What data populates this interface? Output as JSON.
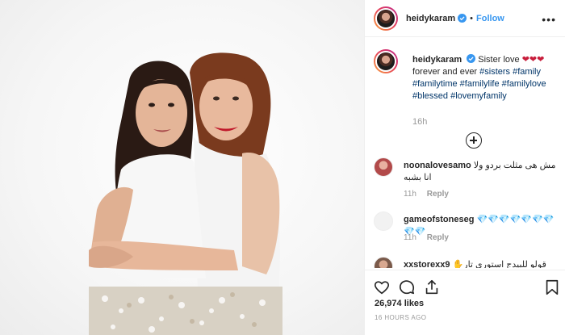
{
  "post": {
    "username": "heidykaram",
    "follow_label": "Follow",
    "more_label": "•••",
    "caption_prefix": "Sister love ",
    "caption_hearts": "❤❤❤",
    "caption_line2": "forever and ever ",
    "hashtags_line2": "#sisters #family",
    "hashtags_line3": "#familytime #familylife #familylove",
    "hashtags_line4": "#blessed #lovemyfamily",
    "age": "16h",
    "likes": "26,974 likes",
    "posted": "16 HOURS AGO"
  },
  "comments": [
    {
      "user": "noonalovesamo",
      "text": "مش هى مثلت بردو ولا انا بشبه",
      "time": "11h",
      "reply": "Reply",
      "avatar_color": "#b24a4a"
    },
    {
      "user": "gameofstoneseg",
      "text": "💎💎💎💎💎💎💎💎💎",
      "time": "11h",
      "reply": "Reply",
      "avatar_color": "#d8d8d8"
    },
    {
      "user": "xxstorexx9",
      "text": "قولو للبيدج استورى تار✋",
      "time": "",
      "reply": "",
      "avatar_color": "#7a5a4a"
    }
  ],
  "icons": {
    "verified": "verified-badge-icon",
    "like": "heart-icon",
    "comment": "comment-icon",
    "share": "share-icon",
    "save": "bookmark-icon",
    "load_more": "plus-circle-icon"
  },
  "colors": {
    "link": "#3897f0",
    "hashtag": "#003569",
    "muted": "#999999",
    "heart": "#ed4956"
  }
}
